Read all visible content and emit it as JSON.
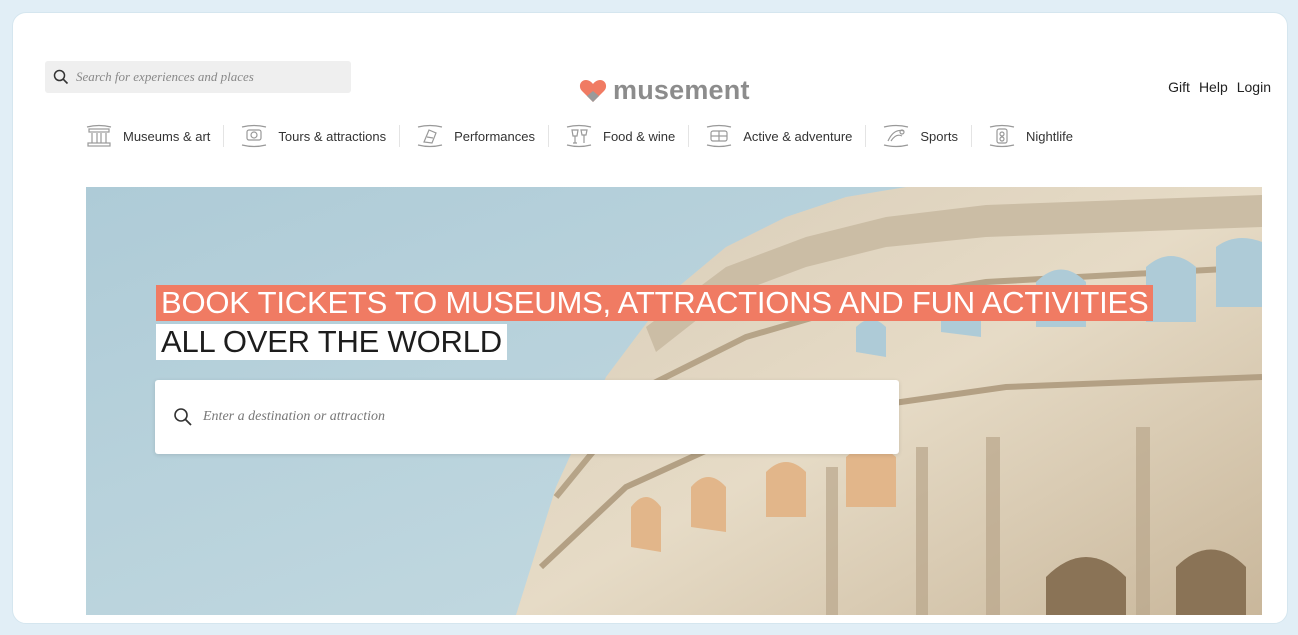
{
  "header": {
    "search_placeholder": "Search for experiences and places",
    "logo_text": "musement",
    "links": [
      "Gift",
      "Help",
      "Login"
    ]
  },
  "categories": [
    {
      "label": "Museums & art",
      "icon": "museum-icon"
    },
    {
      "label": "Tours & attractions",
      "icon": "tours-icon"
    },
    {
      "label": "Performances",
      "icon": "performances-icon"
    },
    {
      "label": "Food & wine",
      "icon": "food-icon"
    },
    {
      "label": "Active & adventure",
      "icon": "adventure-icon"
    },
    {
      "label": "Sports",
      "icon": "sports-icon"
    },
    {
      "label": "Nightlife",
      "icon": "nightlife-icon"
    }
  ],
  "hero": {
    "headline_line1": "BOOK TICKETS TO MUSEUMS, ATTRACTIONS AND FUN ACTIVITIES",
    "headline_line2": "ALL OVER THE WORLD",
    "search_placeholder": "Enter a destination or attraction",
    "image": "colosseum-photo"
  },
  "colors": {
    "brand_coral": "#f07b63",
    "logo_gray": "#8c8c8c",
    "sky": "#b6d2dd",
    "page_bg": "#e1eef6"
  }
}
